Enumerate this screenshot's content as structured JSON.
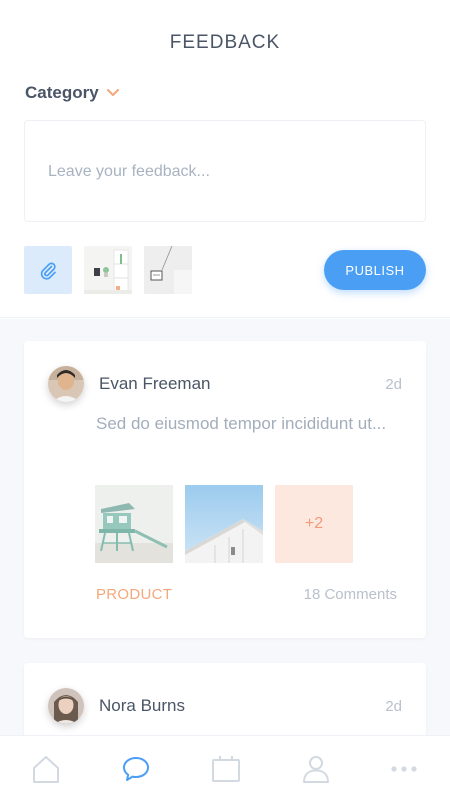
{
  "header": {
    "title": "FEEDBACK"
  },
  "category": {
    "label": "Category",
    "icon": "chevron-down-icon",
    "accent": "#f5a77c"
  },
  "feedback": {
    "placeholder": "Leave your feedback..."
  },
  "attachments": {
    "icon": "paperclip-icon"
  },
  "publish": {
    "label": "PUBLISH",
    "color": "#4a9ff5"
  },
  "posts": [
    {
      "author": "Evan Freeman",
      "time": "2d",
      "text": "Sed do eiusmod tempor incididunt ut...",
      "more_photos": "+2",
      "tag": "PRODUCT",
      "comments": "18 Comments"
    },
    {
      "author": "Nora Burns",
      "time": "2d"
    }
  ],
  "nav": {
    "items": [
      "home-icon",
      "chat-icon",
      "calendar-icon",
      "profile-icon",
      "more-icon"
    ],
    "active": "chat-icon",
    "active_color": "#4a9ff5",
    "inactive_color": "#d3d9e1"
  }
}
